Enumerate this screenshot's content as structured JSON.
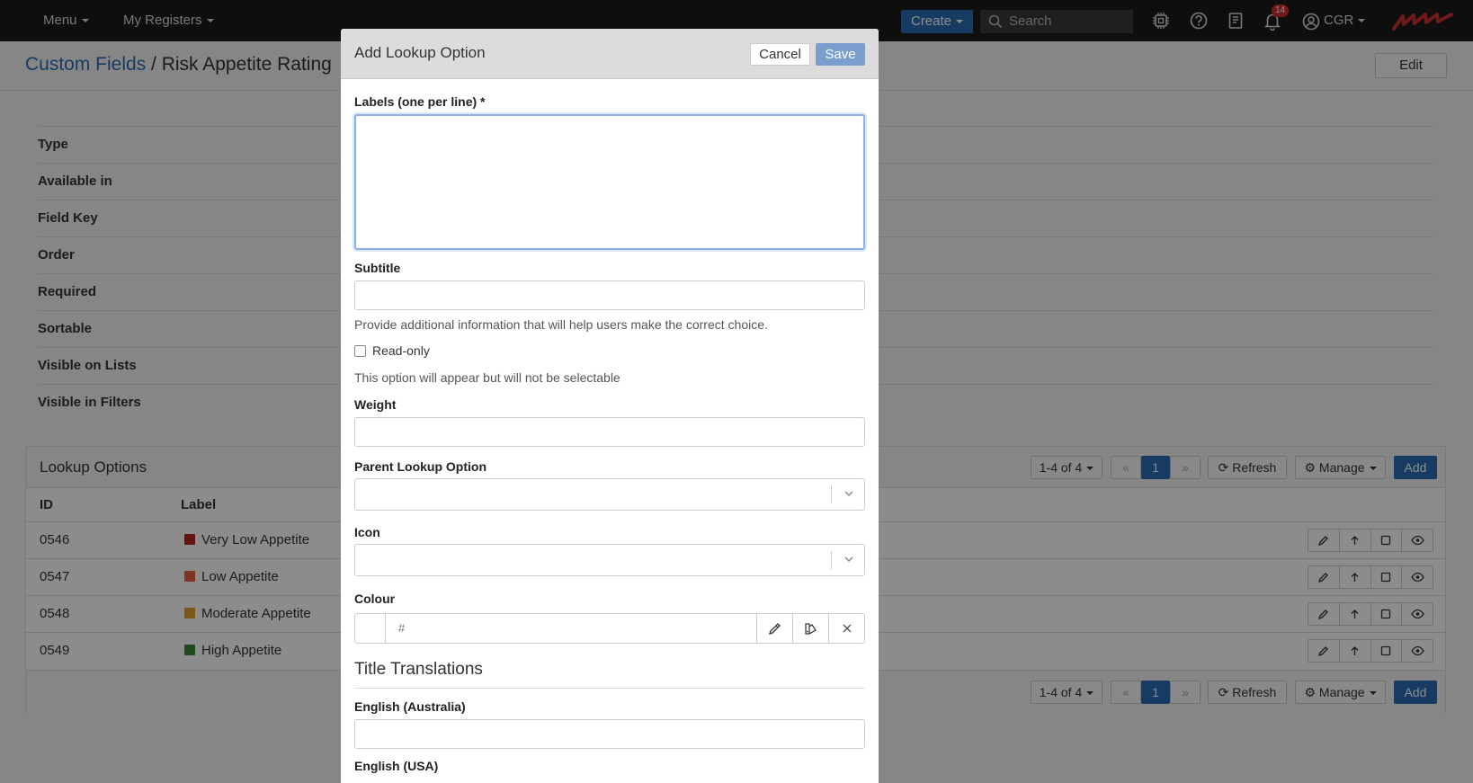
{
  "navbar": {
    "menu_label": "Menu",
    "registers_label": "My Registers",
    "create_label": "Create",
    "search_placeholder": "Search",
    "notification_count": "14",
    "user_label": "CGR",
    "icons": [
      "chip-icon",
      "help-icon",
      "book-icon",
      "bell-icon",
      "user-icon"
    ],
    "brand_color": "#c9302c",
    "accent_color": "#2d6cb5"
  },
  "header": {
    "breadcrumb_link": "Custom Fields",
    "separator": " / ",
    "title": "Risk Appetite Rating",
    "edit_label": "Edit"
  },
  "details": {
    "rows": [
      "Type",
      "Available in",
      "Field Key",
      "Order",
      "Required",
      "Sortable",
      "Visible on Lists",
      "Visible in Filters"
    ]
  },
  "lookup_panel": {
    "title": "Lookup Options",
    "pager_label": "1-4 of 4",
    "page_number": "1",
    "first_label": "«",
    "last_label": "»",
    "refresh_label": "Refresh",
    "manage_label": "Manage",
    "add_label": "Add",
    "columns": [
      "ID",
      "Label"
    ],
    "rows": [
      {
        "id": "0546",
        "label": "Very Low Appetite",
        "color": "#b22222"
      },
      {
        "id": "0547",
        "label": "Low Appetite",
        "color": "#e8623a"
      },
      {
        "id": "0548",
        "label": "Moderate Appetite",
        "color": "#e0a030"
      },
      {
        "id": "0549",
        "label": "High Appetite",
        "color": "#3a8a3a"
      }
    ]
  },
  "modal": {
    "title": "Add Lookup Option",
    "cancel_label": "Cancel",
    "save_label": "Save",
    "labels_label": "Labels (one per line) *",
    "subtitle_label": "Subtitle",
    "subtitle_help": "Provide additional information that will help users make the correct choice.",
    "readonly_label": "Read-only",
    "readonly_help": "This option will appear but will not be selectable",
    "weight_label": "Weight",
    "parent_label": "Parent Lookup Option",
    "icon_label": "Icon",
    "colour_label": "Colour",
    "colour_hash": "#",
    "translations_title": "Title Translations",
    "lang_1": "English (Australia)",
    "lang_2": "English (USA)"
  }
}
